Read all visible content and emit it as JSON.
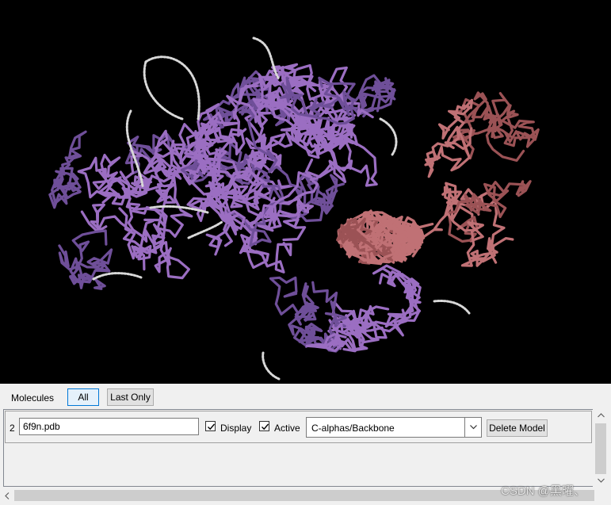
{
  "viewer": {
    "chain_colors": {
      "main": "#9b6ec2",
      "main_dark": "#6f4f99",
      "secondary": "#c07175",
      "secondary_dark": "#9b5255",
      "unresolved": "#d8d8d8"
    }
  },
  "toolbar": {
    "molecules_label": "Molecules",
    "all_button": "All",
    "last_only_button": "Last Only"
  },
  "molecules": [
    {
      "index": "2",
      "filename": "6f9n.pdb",
      "display_label": "Display",
      "display_checked": true,
      "active_label": "Active",
      "active_checked": true,
      "representation": "C-alphas/Backbone",
      "delete_button": "Delete Model"
    }
  ],
  "watermark": "CSDN @黑曜、"
}
